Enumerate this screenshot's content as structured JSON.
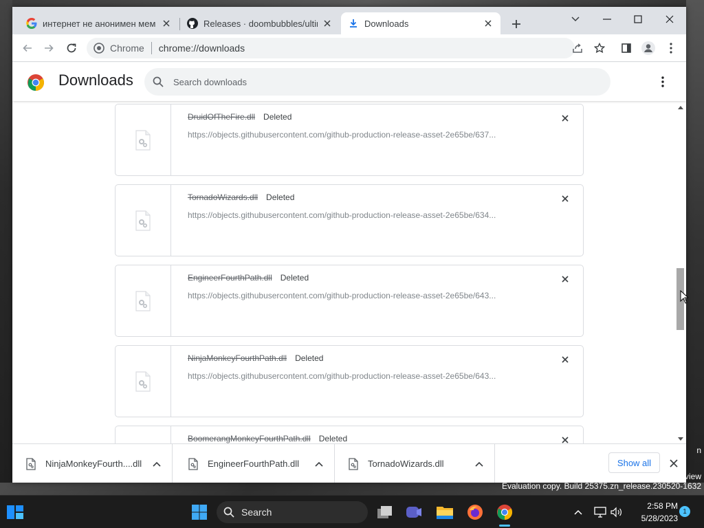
{
  "browser": {
    "tabs": [
      {
        "title": "интернет не анонимен мем - G",
        "icon": "google-icon",
        "active": false
      },
      {
        "title": "Releases · doombubbles/ultima",
        "icon": "github-icon",
        "active": false
      },
      {
        "title": "Downloads",
        "icon": "download-icon",
        "active": true
      }
    ],
    "omnibox": {
      "site_label": "Chrome",
      "url": "chrome://downloads"
    }
  },
  "downloads_page": {
    "title": "Downloads",
    "search_placeholder": "Search downloads",
    "items": [
      {
        "filename": "DruidOfTheFire.dll",
        "status": "Deleted",
        "url": "https://objects.githubusercontent.com/github-production-release-asset-2e65be/637..."
      },
      {
        "filename": "TornadoWizards.dll",
        "status": "Deleted",
        "url": "https://objects.githubusercontent.com/github-production-release-asset-2e65be/634..."
      },
      {
        "filename": "EngineerFourthPath.dll",
        "status": "Deleted",
        "url": "https://objects.githubusercontent.com/github-production-release-asset-2e65be/643..."
      },
      {
        "filename": "NinjaMonkeyFourthPath.dll",
        "status": "Deleted",
        "url": "https://objects.githubusercontent.com/github-production-release-asset-2e65be/643..."
      },
      {
        "filename": "BoomerangMonkeyFourthPath.dll",
        "status": "Deleted",
        "url": ""
      }
    ]
  },
  "download_shelf": {
    "items": [
      {
        "name": "NinjaMonkeyFourth....dll"
      },
      {
        "name": "EngineerFourthPath.dll"
      },
      {
        "name": "TornadoWizards.dll"
      }
    ],
    "show_all_label": "Show all"
  },
  "desktop": {
    "watermark": "Evaluation copy. Build 25375.zn_release.230520-1632",
    "right_edge_text_1": "n",
    "right_edge_text_2": "view"
  },
  "taskbar": {
    "search_label": "Search",
    "time": "2:58 PM",
    "date": "5/28/2023",
    "notification_count": "1"
  },
  "colors": {
    "accent": "#1a73e8",
    "tabstrip": "#dee1e6",
    "taskbar": "#1c1c1c"
  }
}
